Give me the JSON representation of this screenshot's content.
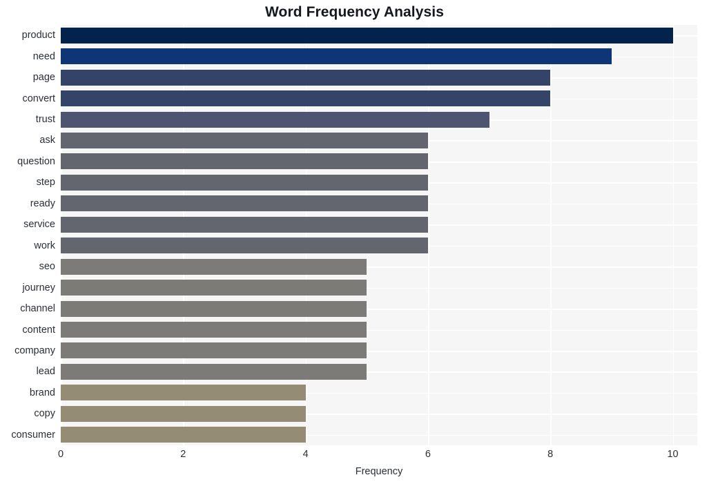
{
  "chart_data": {
    "type": "bar",
    "orientation": "horizontal",
    "title": "Word Frequency Analysis",
    "xlabel": "Frequency",
    "ylabel": "",
    "categories": [
      "product",
      "need",
      "page",
      "convert",
      "trust",
      "ask",
      "question",
      "step",
      "ready",
      "service",
      "work",
      "seo",
      "journey",
      "channel",
      "content",
      "company",
      "lead",
      "brand",
      "copy",
      "consumer"
    ],
    "values": [
      10,
      9,
      8,
      8,
      7,
      6,
      6,
      6,
      6,
      6,
      6,
      5,
      5,
      5,
      5,
      5,
      5,
      4,
      4,
      4
    ],
    "bar_colors": [
      "#04234c",
      "#0e3575",
      "#344468",
      "#344468",
      "#4d5570",
      "#64666f",
      "#64666f",
      "#64666f",
      "#64666f",
      "#64666f",
      "#64666f",
      "#7c7b78",
      "#7c7b78",
      "#7c7b78",
      "#7c7b78",
      "#7c7b78",
      "#7c7b78",
      "#948c74",
      "#948c74",
      "#948c74"
    ],
    "xlim": [
      0,
      10.4
    ],
    "xticks": [
      0,
      2,
      4,
      6,
      8,
      10
    ],
    "xtick_labels": [
      "0",
      "2",
      "4",
      "6",
      "8",
      "10"
    ],
    "grid": true,
    "grid_color": "#ffffff",
    "plot_background": "#f6f6f7",
    "figure_background": "#ffffff",
    "legend": null
  }
}
